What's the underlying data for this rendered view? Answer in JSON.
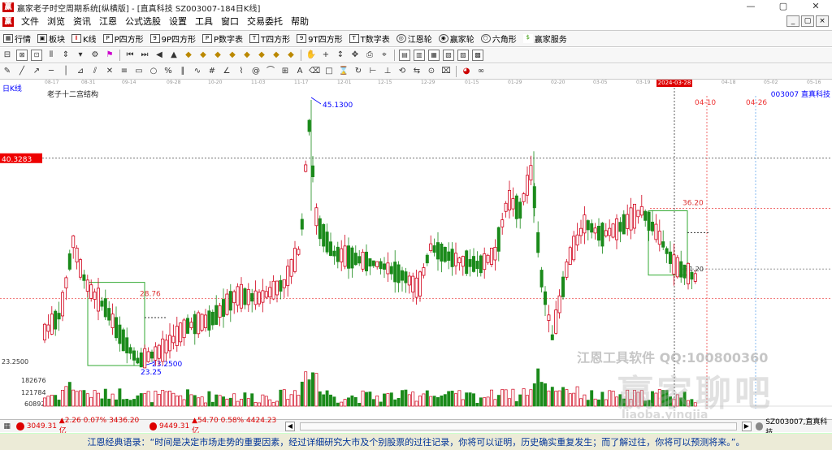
{
  "window": {
    "title": "赢家老子时空周期系统[纵横版] - [直真科技 SZ003007-184日K线]",
    "controls": [
      "—",
      "▢",
      "✕"
    ]
  },
  "menu": {
    "items": [
      "文件",
      "浏览",
      "资讯",
      "江恩",
      "公式选股",
      "设置",
      "工具",
      "窗口",
      "交易委托",
      "帮助"
    ],
    "mdi_controls": [
      "_",
      "▢",
      "×"
    ]
  },
  "toolbar1": {
    "items": [
      "行情",
      "板块",
      "K线",
      "P四方形",
      "9P四方形",
      "P数字表",
      "T四方形",
      "9T四方形",
      "T数字表",
      "江恩轮",
      "赢家轮",
      "六角形",
      "赢家服务"
    ]
  },
  "date_axis": {
    "ticks": [
      "08-17",
      "08-31",
      "09-14",
      "09-28",
      "10-20",
      "11-03",
      "11-17",
      "12-01",
      "12-15",
      "12-29",
      "01-15",
      "01-29",
      "02-20",
      "03-05",
      "03-19",
      "04-18",
      "05-02",
      "05-16"
    ],
    "highlight": "2024-03-28"
  },
  "chart": {
    "period_label": "日K线",
    "structure_label": "老子十二宫结构",
    "stock_code_label": "003007  直真科技",
    "price_tag": "40.3283",
    "high_label": "45.1300",
    "low_label": "23.2500",
    "low_bottom_label": "23.25",
    "level_28": "28.76",
    "level_36": "36.20",
    "level_31": "31.20",
    "left_axis_low": "23.2500",
    "date_mark_1": "04-10",
    "date_mark_2": "04-26",
    "volume_labels": [
      "182676",
      "121784",
      "60892"
    ]
  },
  "chart_data": {
    "type": "candlestick",
    "title": "老子十二宫结构",
    "high": 45.13,
    "low": 23.25,
    "levels": [
      40.3283,
      36.2,
      31.2,
      28.76,
      23.25
    ],
    "volume_axis": [
      182676,
      121784,
      60892
    ]
  },
  "statusbar": {
    "index1": "3049.31",
    "index1_change": "▲2.26 0.07% 3436.20亿",
    "index2": "9449.31",
    "index2_change": "▲54.70 0.58% 4424.23亿",
    "stock": "SZ003007,直真科技"
  },
  "quote": "江恩经典语录：“时间是决定市场走势的重要因素，经过详细研究大市及个别股票的过往记录，你将可以证明，历史确实重复发生；而了解过往，你将可以预测将来。”。",
  "watermark": {
    "text1": "江恩工具软件 QQ:100800360",
    "text2": "赢家聊吧",
    "text3": "liaoba.yingjia"
  },
  "colors": {
    "up": "#d0021b",
    "down": "#1a8a1a",
    "accent": "#0000ff"
  }
}
